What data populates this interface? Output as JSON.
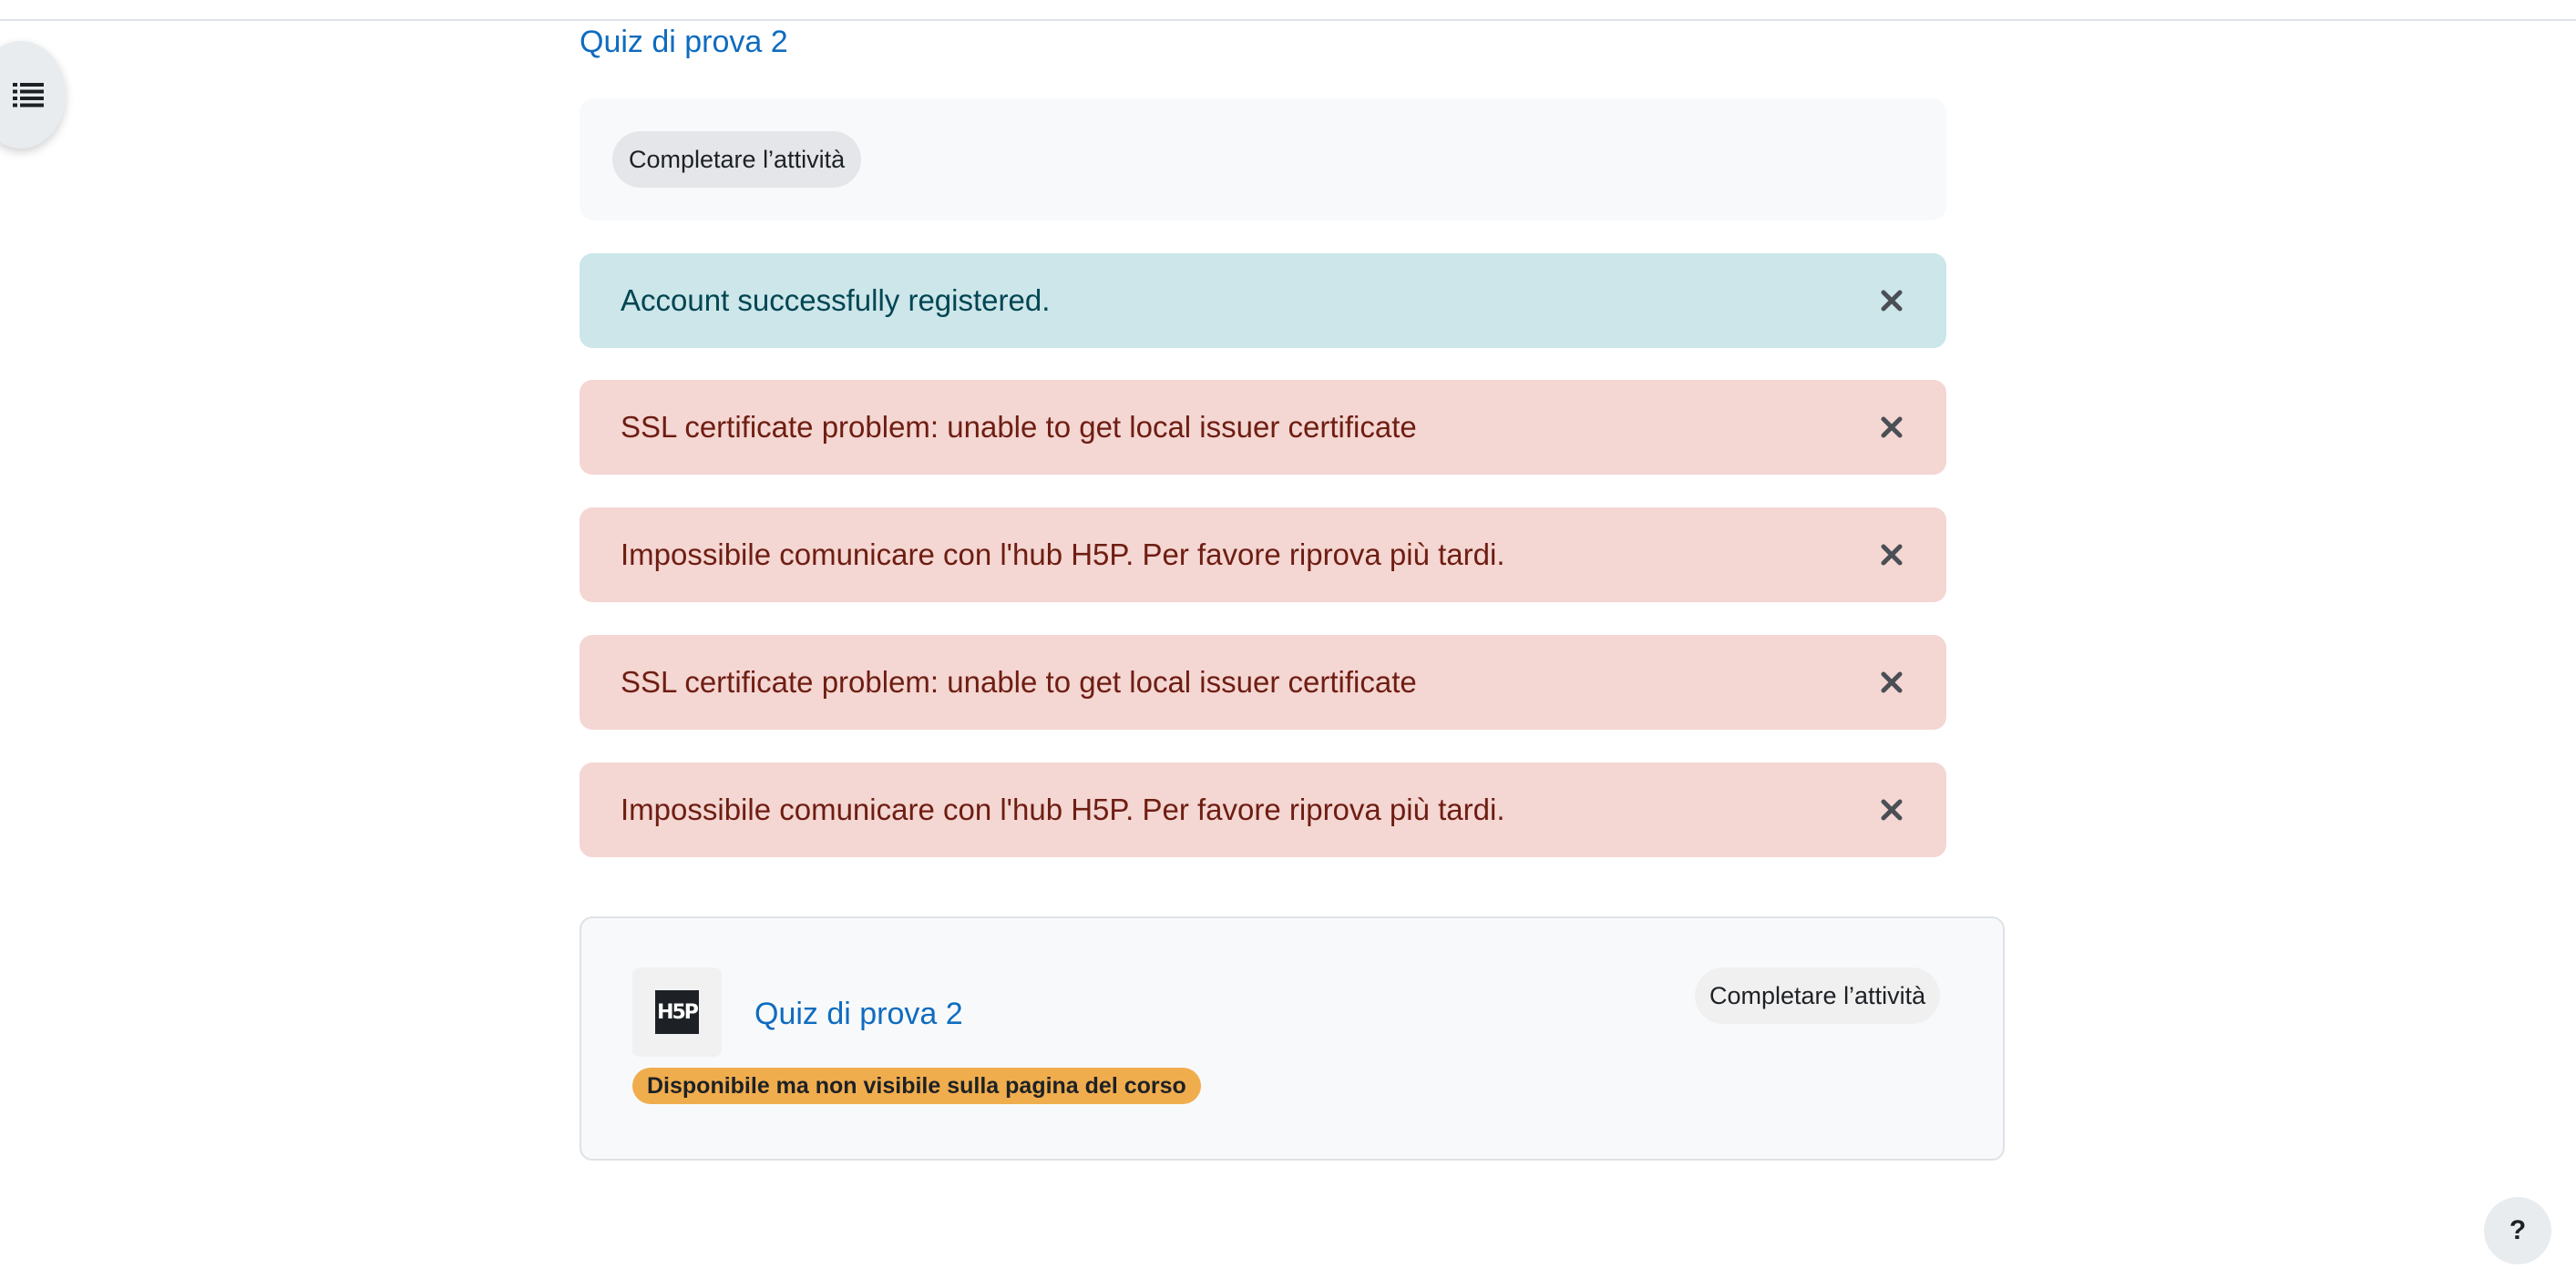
{
  "page": {
    "title": "Quiz di prova 2"
  },
  "completion": {
    "button_label": "Completare l’attività"
  },
  "alerts": [
    {
      "type": "info",
      "message": "Account successfully registered."
    },
    {
      "type": "danger",
      "message": "SSL certificate problem: unable to get local issuer certificate"
    },
    {
      "type": "danger",
      "message": "Impossibile comunicare con l'hub H5P. Per favore riprova più tardi."
    },
    {
      "type": "danger",
      "message": "SSL certificate problem: unable to get local issuer certificate"
    },
    {
      "type": "danger",
      "message": "Impossibile comunicare con l'hub H5P. Per favore riprova più tardi."
    }
  ],
  "activity": {
    "icon": "h5p-icon",
    "logo_text": "H5P",
    "title": "Quiz di prova 2",
    "completion_label": "Completare l’attività",
    "visibility_badge": "Disponibile ma non visibile sulla pagina del corso"
  },
  "help": {
    "label": "?"
  },
  "colors": {
    "link": "#0f6cbf",
    "info_bg": "#cce6ea",
    "danger_bg": "#f4d6d2",
    "badge_warning": "#f0ad4e"
  }
}
